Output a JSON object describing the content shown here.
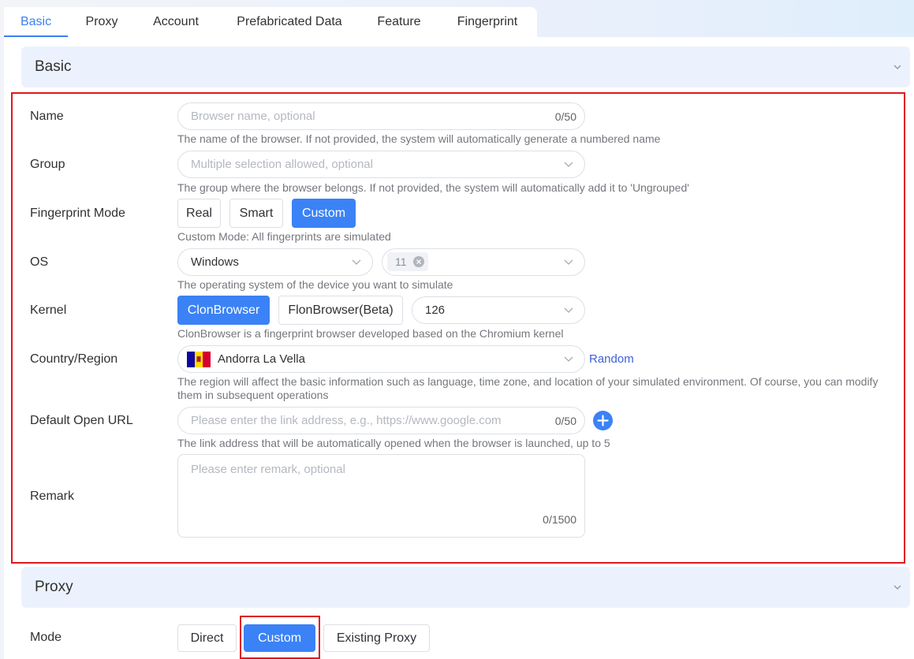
{
  "tabs": [
    "Basic",
    "Proxy",
    "Account",
    "Prefabricated Data",
    "Feature",
    "Fingerprint"
  ],
  "sections": {
    "basic_title": "Basic",
    "proxy_title": "Proxy"
  },
  "form": {
    "name": {
      "label": "Name",
      "placeholder": "Browser name, optional",
      "count": "0/50",
      "hint": "The name of the browser. If not provided, the system will automatically generate a numbered name"
    },
    "group": {
      "label": "Group",
      "placeholder": "Multiple selection allowed, optional",
      "hint": "The group where the browser belongs. If not provided, the system will automatically add it to 'Ungrouped'"
    },
    "fingerprint_mode": {
      "label": "Fingerprint Mode",
      "options": [
        "Real",
        "Smart",
        "Custom"
      ],
      "selected": "Custom",
      "hint": "Custom Mode: All fingerprints are simulated"
    },
    "os": {
      "label": "OS",
      "value": "Windows",
      "version_tag": "11",
      "hint": "The operating system of the device you want to simulate"
    },
    "kernel": {
      "label": "Kernel",
      "options": [
        "ClonBrowser",
        "FlonBrowser(Beta)"
      ],
      "selected": "ClonBrowser",
      "version": "126",
      "hint": "ClonBrowser is a fingerprint browser developed based on the Chromium kernel"
    },
    "country": {
      "label": "Country/Region",
      "value": "Andorra La Vella",
      "random_label": "Random",
      "hint1": "The region will affect the basic information such as language, time zone, and location of your simulated environment. Of course, you can modify",
      "hint2": "them in subsequent operations"
    },
    "url": {
      "label": "Default Open URL",
      "placeholder": "Please enter the link address, e.g., https://www.google.com",
      "count": "0/50",
      "hint": "The link address that will be automatically opened when the browser is launched, up to 5"
    },
    "remark": {
      "label": "Remark",
      "placeholder": "Please enter remark, optional",
      "count": "0/1500"
    }
  },
  "proxy": {
    "mode_label": "Mode",
    "options": [
      "Direct",
      "Custom",
      "Existing Proxy"
    ],
    "selected": "Custom"
  },
  "colors": {
    "accent": "#3b82f6",
    "highlight": "#e0161f"
  }
}
